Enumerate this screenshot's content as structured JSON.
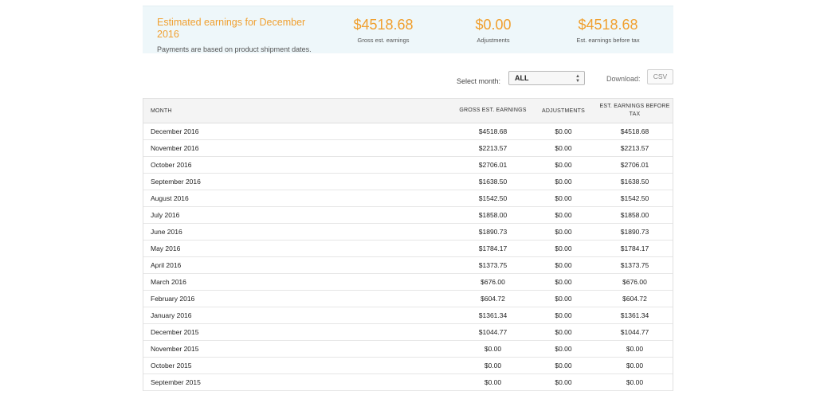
{
  "summary": {
    "title": "Estimated earnings for December 2016",
    "note": "Payments are based on product shipment dates.",
    "gross_value": "$4518.68",
    "gross_label": "Gross est. earnings",
    "adjustments_value": "$0.00",
    "adjustments_label": "Adjustments",
    "before_tax_value": "$4518.68",
    "before_tax_label": "Est. earnings before tax"
  },
  "controls": {
    "select_month_label": "Select month:",
    "select_month_value": "ALL",
    "download_label": "Download:",
    "csv_label": "CSV"
  },
  "table": {
    "headers": {
      "month": "MONTH",
      "gross": "GROSS EST. EARNINGS",
      "adjustments": "ADJUSTMENTS",
      "before_tax": "EST. EARNINGS BEFORE TAX"
    },
    "rows": [
      {
        "month": "December 2016",
        "gross": "$4518.68",
        "adjustments": "$0.00",
        "before_tax": "$4518.68"
      },
      {
        "month": "November 2016",
        "gross": "$2213.57",
        "adjustments": "$0.00",
        "before_tax": "$2213.57"
      },
      {
        "month": "October 2016",
        "gross": "$2706.01",
        "adjustments": "$0.00",
        "before_tax": "$2706.01"
      },
      {
        "month": "September 2016",
        "gross": "$1638.50",
        "adjustments": "$0.00",
        "before_tax": "$1638.50"
      },
      {
        "month": "August 2016",
        "gross": "$1542.50",
        "adjustments": "$0.00",
        "before_tax": "$1542.50"
      },
      {
        "month": "July 2016",
        "gross": "$1858.00",
        "adjustments": "$0.00",
        "before_tax": "$1858.00"
      },
      {
        "month": "June 2016",
        "gross": "$1890.73",
        "adjustments": "$0.00",
        "before_tax": "$1890.73"
      },
      {
        "month": "May 2016",
        "gross": "$1784.17",
        "adjustments": "$0.00",
        "before_tax": "$1784.17"
      },
      {
        "month": "April 2016",
        "gross": "$1373.75",
        "adjustments": "$0.00",
        "before_tax": "$1373.75"
      },
      {
        "month": "March 2016",
        "gross": "$676.00",
        "adjustments": "$0.00",
        "before_tax": "$676.00"
      },
      {
        "month": "February 2016",
        "gross": "$604.72",
        "adjustments": "$0.00",
        "before_tax": "$604.72"
      },
      {
        "month": "January 2016",
        "gross": "$1361.34",
        "adjustments": "$0.00",
        "before_tax": "$1361.34"
      },
      {
        "month": "December 2015",
        "gross": "$1044.77",
        "adjustments": "$0.00",
        "before_tax": "$1044.77"
      },
      {
        "month": "November 2015",
        "gross": "$0.00",
        "adjustments": "$0.00",
        "before_tax": "$0.00"
      },
      {
        "month": "October 2015",
        "gross": "$0.00",
        "adjustments": "$0.00",
        "before_tax": "$0.00"
      },
      {
        "month": "September 2015",
        "gross": "$0.00",
        "adjustments": "$0.00",
        "before_tax": "$0.00"
      }
    ]
  },
  "colors": {
    "accent": "#f0a030",
    "summary_bg": "#eef7fa",
    "header_bg": "#f4f4f4"
  },
  "icons": {
    "select_arrows": "updown-arrows-icon"
  }
}
